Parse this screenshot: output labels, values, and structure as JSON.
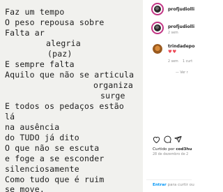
{
  "post": {
    "poem_lines": [
      "Faz um tempo",
      "O peso repousa sobre",
      "Falta ar",
      "alegria",
      "(paz)",
      "E sempre falta",
      "Aquilo que não se articula",
      "organiza",
      "surge",
      "E todos os pedaços estão",
      "lá",
      "na ausência",
      "do TUDO já dito",
      "O que não se escuta",
      "e foge a se esconder",
      "silenciosamente",
      "Como tudo que é ruim",
      "se move."
    ]
  },
  "comments": [
    {
      "username": "profjudiolli",
      "meta": ""
    },
    {
      "username": "profjudiolli",
      "meta": "2 sem"
    },
    {
      "username": "trindadepo",
      "text": "♥♥",
      "meta": "2 sem",
      "meta2": "1 curt",
      "meta3": "— Ver r"
    }
  ],
  "footer": {
    "liked_prefix": "Curtido por ",
    "liked_user": "cod3hu",
    "date": "28 de dezembro de 2",
    "login_link": "Entrar",
    "login_rest": " para curtir ou"
  },
  "colors": {
    "ring": "#c13584",
    "link": "#0095f6",
    "heart": "#ed4956"
  },
  "icons": [
    "heart-icon",
    "comment-icon",
    "share-icon"
  ]
}
